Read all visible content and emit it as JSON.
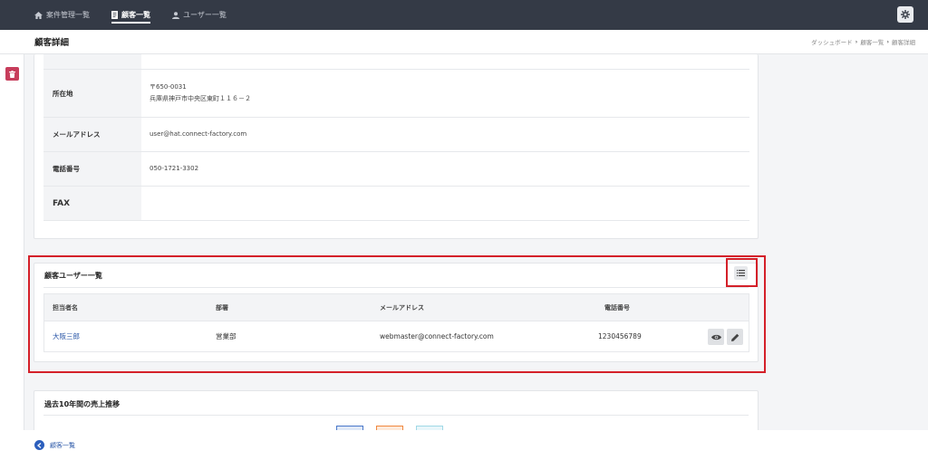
{
  "nav": {
    "items": [
      {
        "label": "案件管理一覧",
        "icon": "home-icon",
        "active": false
      },
      {
        "label": "顧客一覧",
        "icon": "document-icon",
        "active": true
      },
      {
        "label": "ユーザー一覧",
        "icon": "user-icon",
        "active": false
      }
    ],
    "settings_icon": "gear-icon"
  },
  "header": {
    "title": "顧客詳細",
    "breadcrumb": [
      "ダッシュボード",
      "顧客一覧",
      "顧客詳細"
    ]
  },
  "info": {
    "rows": [
      {
        "label": "所在地",
        "lines": [
          "〒650-0031",
          "兵庫県神戸市中央区東町１１６－２"
        ]
      },
      {
        "label": "メールアドレス",
        "lines": [
          "user@hat.connect-factory.com"
        ]
      },
      {
        "label": "電話番号",
        "lines": [
          "050-1721-3302"
        ]
      },
      {
        "label": "FAX",
        "lines": [
          ""
        ]
      }
    ]
  },
  "users": {
    "title": "顧客ユーザー一覧",
    "columns": [
      "担当者名",
      "部署",
      "メールアドレス",
      "電話番号"
    ],
    "rows": [
      {
        "name": "大阪三郎",
        "dept": "営業部",
        "email": "webmaster@connect-factory.com",
        "phone": "1230456789"
      }
    ]
  },
  "sales": {
    "title": "過去10年間の売上推移"
  },
  "footer": {
    "back_label": "顧客一覧"
  },
  "colors": {
    "nav_bg": "#343a46",
    "accent": "#2c58a8",
    "danger": "#c73d5b",
    "highlight": "#d42029",
    "legend": [
      "#4a78c9",
      "#f0883e",
      "#9fd8e6"
    ]
  }
}
